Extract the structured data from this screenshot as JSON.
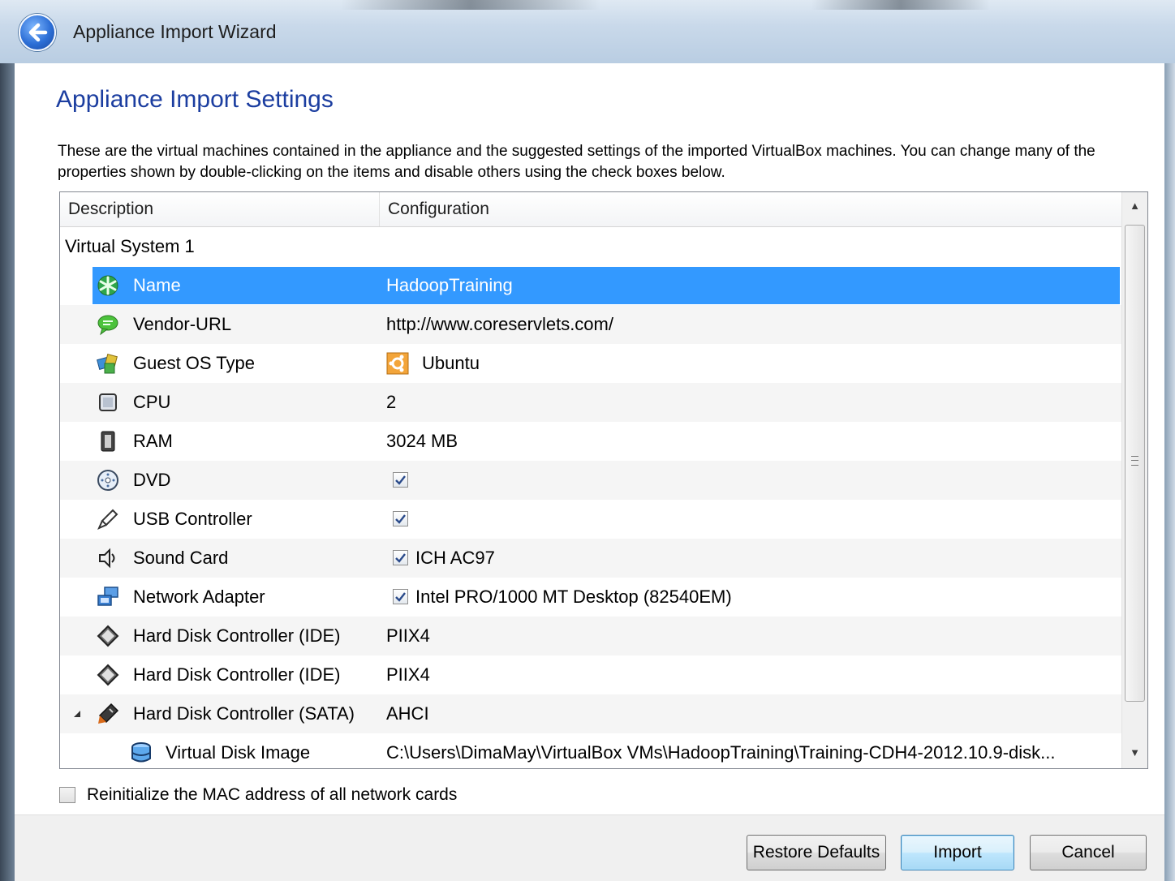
{
  "window": {
    "title": "Appliance Import Wizard"
  },
  "page": {
    "heading": "Appliance Import Settings",
    "description": "These are the virtual machines contained in the appliance and the suggested settings of the imported VirtualBox machines. You can change many of the properties shown by double-clicking on the items and disable others using the check boxes below."
  },
  "table": {
    "columns": [
      "Description",
      "Configuration"
    ],
    "group": "Virtual System 1",
    "rows": [
      {
        "icon": "name-icon",
        "label": "Name",
        "value": "HadoopTraining",
        "selected": true
      },
      {
        "icon": "vendor-url-icon",
        "label": "Vendor-URL",
        "value": "http://www.coreservlets.com/"
      },
      {
        "icon": "guest-os-icon",
        "label": "Guest OS Type",
        "value": "Ubuntu",
        "value_icon": "ubuntu-icon"
      },
      {
        "icon": "cpu-icon",
        "label": "CPU",
        "value": "2"
      },
      {
        "icon": "ram-icon",
        "label": "RAM",
        "value": "3024 MB"
      },
      {
        "icon": "dvd-icon",
        "label": "DVD",
        "value": "",
        "checked": true
      },
      {
        "icon": "usb-icon",
        "label": "USB Controller",
        "value": "",
        "checked": true
      },
      {
        "icon": "sound-card-icon",
        "label": "Sound Card",
        "value": "ICH AC97",
        "checked": true
      },
      {
        "icon": "network-adapter-icon",
        "label": "Network Adapter",
        "value": "Intel PRO/1000 MT Desktop (82540EM)",
        "checked": true
      },
      {
        "icon": "ide-controller-icon",
        "label": "Hard Disk Controller (IDE)",
        "value": "PIIX4"
      },
      {
        "icon": "ide-controller-icon",
        "label": "Hard Disk Controller (IDE)",
        "value": "PIIX4"
      },
      {
        "icon": "sata-controller-icon",
        "label": "Hard Disk Controller (SATA)",
        "value": "AHCI",
        "expanded": true
      },
      {
        "icon": "virtual-disk-icon",
        "label": "Virtual Disk Image",
        "value": "C:\\Users\\DimaMay\\VirtualBox VMs\\HadoopTraining\\Training-CDH4-2012.10.9-disk..."
      }
    ]
  },
  "options": {
    "reinit_mac": "Reinitialize the MAC address of all network cards",
    "reinit_mac_checked": false
  },
  "buttons": {
    "restore": "Restore Defaults",
    "import": "Import",
    "cancel": "Cancel"
  },
  "colors": {
    "heading": "#1c3ea0",
    "selection": "#3399ff"
  }
}
